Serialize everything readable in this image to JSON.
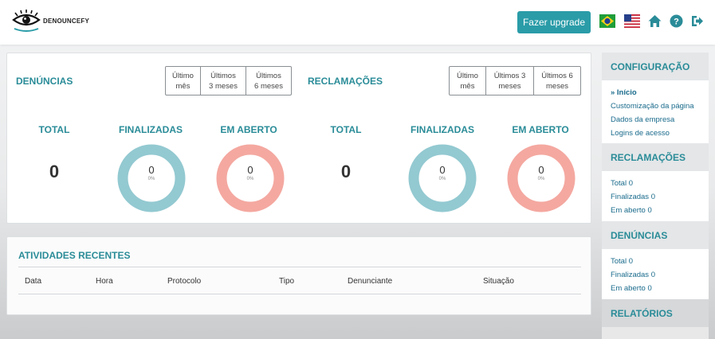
{
  "header": {
    "brand": "DENOUNCEFY",
    "upgrade_label": "Fazer upgrade",
    "icons": [
      "brazil-flag-icon",
      "usa-flag-icon",
      "home-icon",
      "help-icon",
      "logout-icon"
    ]
  },
  "colors": {
    "accent": "#2a9ca8",
    "title": "#2a8c98",
    "donut_finalizadas": "#93c9d1",
    "donut_em_aberto": "#f4a8a0"
  },
  "denuncias": {
    "title": "DENÚNCIAS",
    "periods": [
      {
        "line1": "Último",
        "line2": "mês"
      },
      {
        "line1": "Últimos",
        "line2": "3 meses"
      },
      {
        "line1": "Últimos",
        "line2": "6 meses"
      }
    ],
    "total_label": "TOTAL",
    "total_value": "0",
    "finalizadas_label": "FINALIZADAS",
    "finalizadas_value": "0",
    "finalizadas_pct": "0%",
    "em_aberto_label": "EM ABERTO",
    "em_aberto_value": "0",
    "em_aberto_pct": "0%"
  },
  "reclamacoes": {
    "title": "RECLAMAÇÕES",
    "periods": [
      {
        "line1": "Último",
        "line2": "mês"
      },
      {
        "line1": "Últimos 3",
        "line2": "meses"
      },
      {
        "line1": "Últimos 6",
        "line2": "meses"
      }
    ],
    "total_label": "TOTAL",
    "total_value": "0",
    "finalizadas_label": "FINALIZADAS",
    "finalizadas_value": "0",
    "finalizadas_pct": "0%",
    "em_aberto_label": "EM ABERTO",
    "em_aberto_value": "0",
    "em_aberto_pct": "0%"
  },
  "activities": {
    "title": "ATIVIDADES RECENTES",
    "columns": [
      "Data",
      "Hora",
      "Protocolo",
      "Tipo",
      "Denunciante",
      "Situação"
    ]
  },
  "sidebar": {
    "configuracao": {
      "title": "CONFIGURAÇÃO",
      "items": [
        "» Início",
        "Customização da página",
        "Dados da empresa",
        "Logins de acesso"
      ]
    },
    "reclamacoes": {
      "title": "RECLAMAÇÕES",
      "items": [
        "Total 0",
        "Finalizadas 0",
        "Em aberto 0"
      ]
    },
    "denuncias": {
      "title": "DENÚNCIAS",
      "items": [
        "Total 0",
        "Finalizadas 0",
        "Em aberto 0"
      ]
    },
    "relatorios": {
      "title": "RELATÓRIOS"
    }
  }
}
